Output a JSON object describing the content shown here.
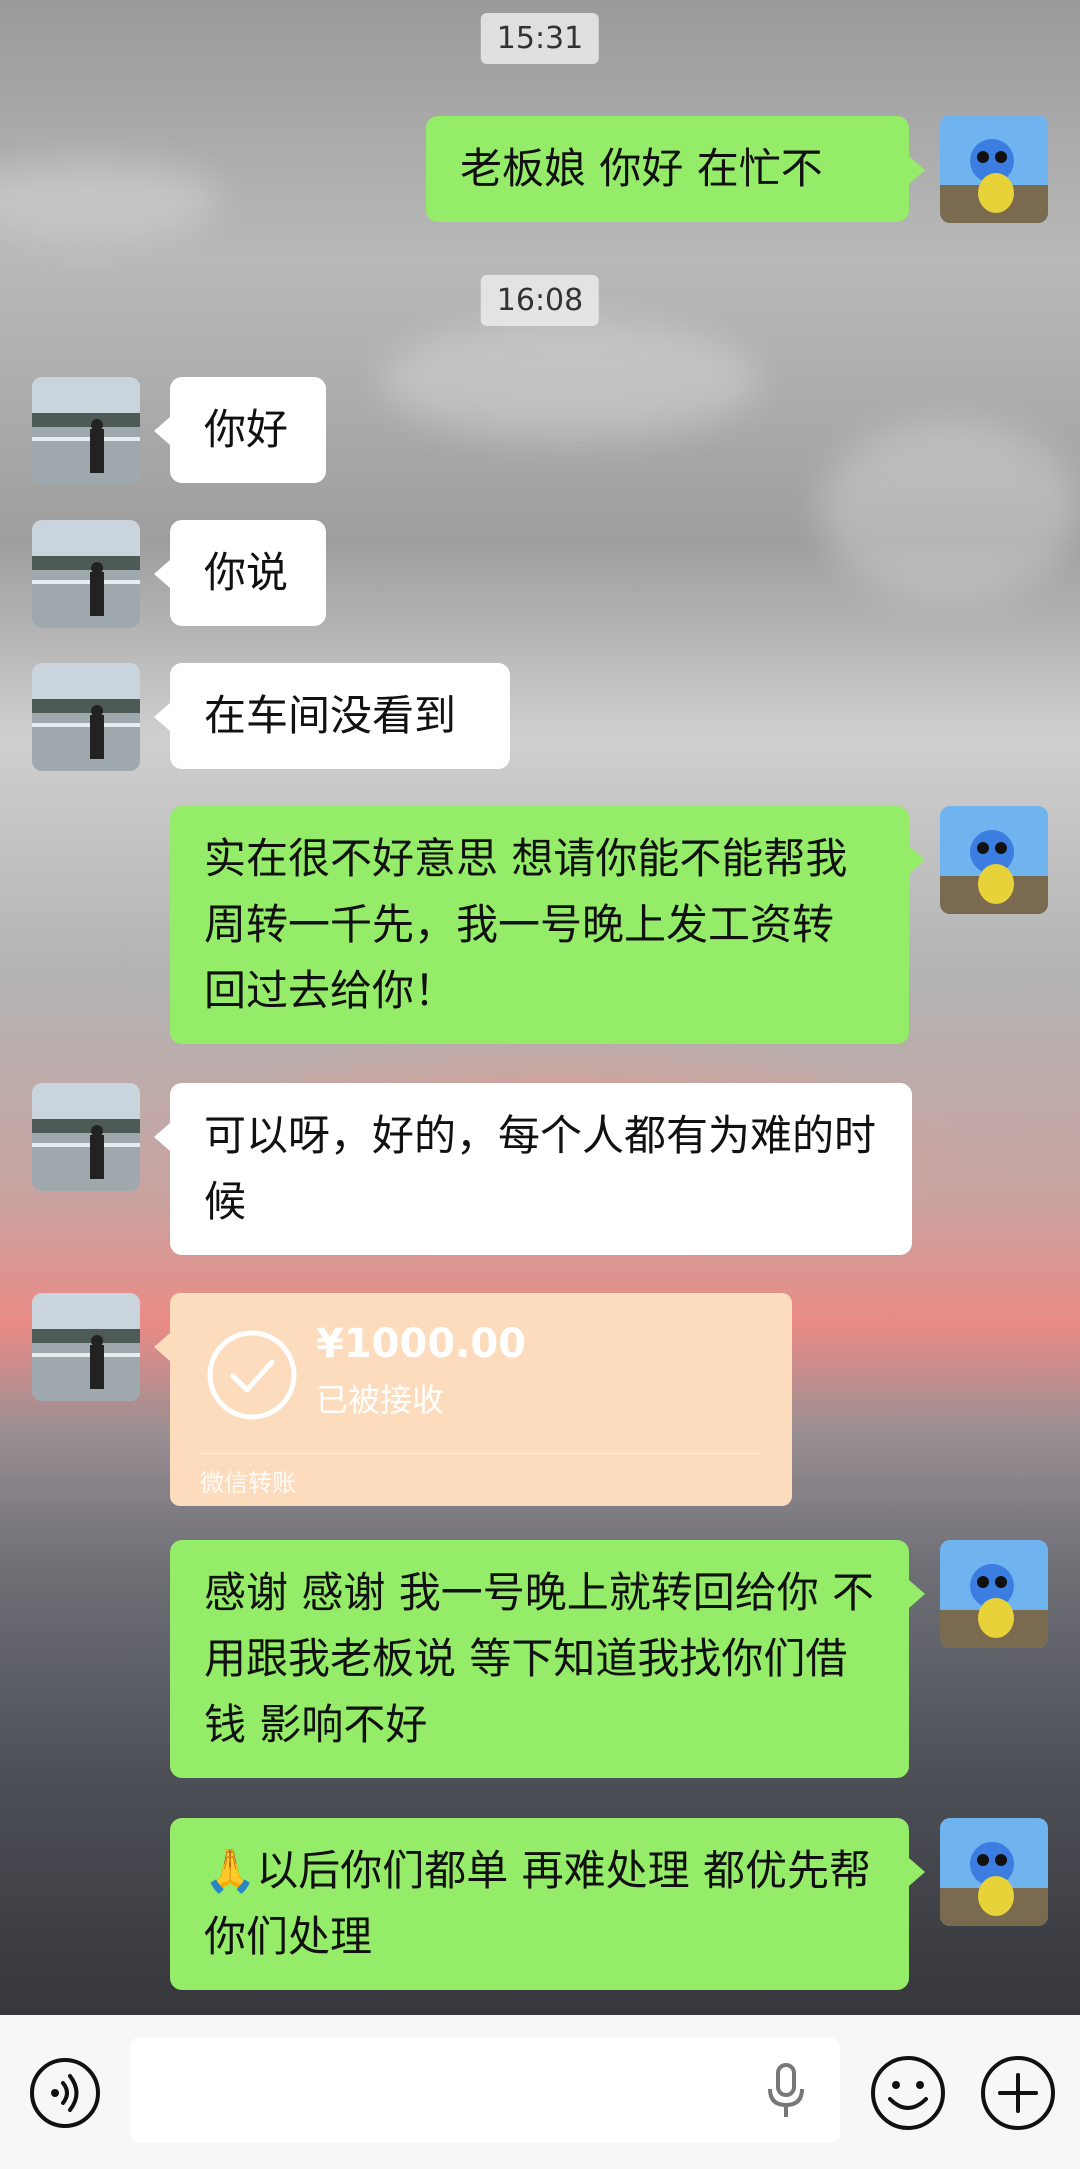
{
  "timestamps": [
    "15:31",
    "16:08"
  ],
  "messages": {
    "m1": "老板娘  你好  在忙不",
    "m2": "你好",
    "m3": "你说",
    "m4": "在车间没看到",
    "m5": "实在很不好意思  想请你能不能帮我周转一千先，我一号晚上发工资转回过去给你！",
    "m6": "可以呀，好的，每个人都有为难的时候",
    "m8": "感谢  感谢  我一号晚上就转回给你    不用跟我老板说  等下知道我找你们借钱  影响不好",
    "m9": "🙏以后你们都单  再难处理  都优先帮你们处理"
  },
  "transfer": {
    "amount": "¥1000.00",
    "status": "已被接收",
    "label": "微信转账",
    "color": "#fcdcbc"
  },
  "colors": {
    "my_bubble": "#95ec69",
    "their_bubble": "#ffffff",
    "bottom_bar": "#f7f7f7"
  },
  "icons": [
    "voice-icon",
    "microphone-icon",
    "emoji-icon",
    "plus-icon",
    "check-circle-icon"
  ]
}
